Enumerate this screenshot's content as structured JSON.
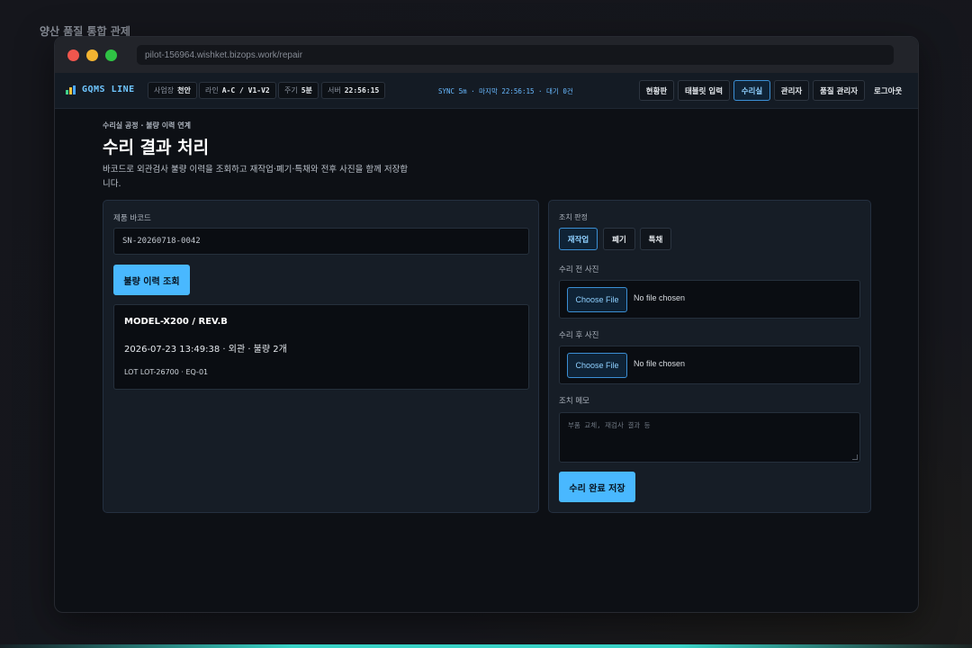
{
  "page_label": "양산 품질 통합 관제",
  "browser": {
    "url": "pilot-156964.wishket.bizops.work/repair"
  },
  "navbar": {
    "brand": "GQMS LINE",
    "chips": [
      {
        "label": "사업장",
        "value": "천안"
      },
      {
        "label": "라인",
        "value": "A-C / V1-V2"
      },
      {
        "label": "주기",
        "value": "5분"
      },
      {
        "label": "서버",
        "value": "22:56:15"
      }
    ],
    "sync_status": "SYNC 5m · 마지막 22:56:15 · 대기 0건",
    "buttons": [
      "현황판",
      "태블릿 입력",
      "수리실",
      "관리자",
      "품질 관리자"
    ],
    "active_button": "수리실",
    "logout": "로그아웃"
  },
  "header": {
    "breadcrumb": "수리실 공정 · 불량 이력 연계",
    "title": "수리 결과 처리",
    "description": "바코드로 외관검사 불량 이력을 조회하고 재작업·폐기·특채와 전후 사진을 함께 저장합니다."
  },
  "left_panel": {
    "barcode_label": "제품 바코드",
    "barcode_value": "SN-20260718-0042",
    "lookup_button": "불량 이력 조회",
    "result": {
      "model": "MODEL-X200 / REV.B",
      "detail": "2026-07-23 13:49:38 · 외관 · 불량 2개",
      "lot": "LOT LOT-26700 · EQ-01"
    }
  },
  "right_panel": {
    "decision_label": "조치 판정",
    "decisions": [
      "재작업",
      "폐기",
      "특채"
    ],
    "selected_decision": "재작업",
    "before_photo_label": "수리 전 사진",
    "after_photo_label": "수리 후 사진",
    "file_button": "Choose File",
    "file_status": "No file chosen",
    "memo_label": "조치 메모",
    "memo_placeholder": "부품 교체, 재검사 결과 등",
    "save_button": "수리 완료 저장"
  },
  "colors": {
    "accent": "#49b8ff",
    "background": "#0d1015",
    "panel": "#161d26"
  }
}
